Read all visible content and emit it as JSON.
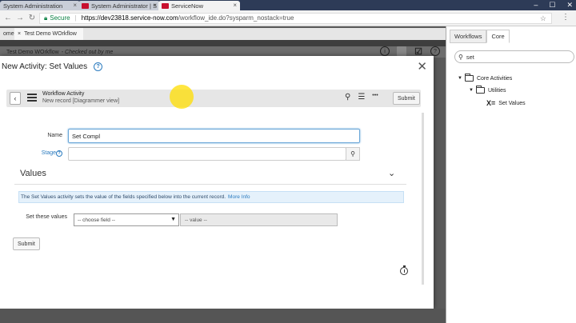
{
  "browser": {
    "tabs": [
      {
        "label": "System Administration"
      },
      {
        "label": "System Administrator | S"
      },
      {
        "label": "ServiceNow"
      }
    ],
    "tab_close": "×",
    "secure_label": "Secure",
    "url_host": "https://dev23818.service-now.com",
    "url_path": "/workflow_ide.do?sysparm_nostack=true",
    "win_min": "–",
    "win_max": "☐",
    "win_close": "✕"
  },
  "app": {
    "tabs": [
      {
        "label": "ome"
      },
      {
        "label": "Test Demo WOrkflow"
      }
    ],
    "tab_close": "×",
    "workflow_title": "Test Demo WOrkflow",
    "checked_out": "- Checked out by me"
  },
  "right_panel": {
    "tabs": [
      {
        "label": "Workflows"
      },
      {
        "label": "Core"
      }
    ],
    "search_value": "set",
    "tree": [
      {
        "label": "Core Activities"
      },
      {
        "label": "Utilities"
      },
      {
        "label": "Set Values"
      }
    ]
  },
  "modal": {
    "title": "New Activity: Set Values",
    "help": "?",
    "close": "✕",
    "header": {
      "title": "Workflow Activity",
      "subtitle": "New record [Diagrammer view]",
      "more": "•••",
      "submit": "Submit"
    },
    "form": {
      "name_label": "Name",
      "name_value": "Set Compl",
      "stage_label": "Stage",
      "values_section": "Values",
      "info_text": "The Set Values activity sets the value of the fields specified below into the current record.",
      "info_link": "More Info",
      "set_values_label": "Set these values",
      "field_placeholder": "-- choose field --",
      "value_placeholder": "-- value --",
      "submit": "Submit"
    }
  }
}
